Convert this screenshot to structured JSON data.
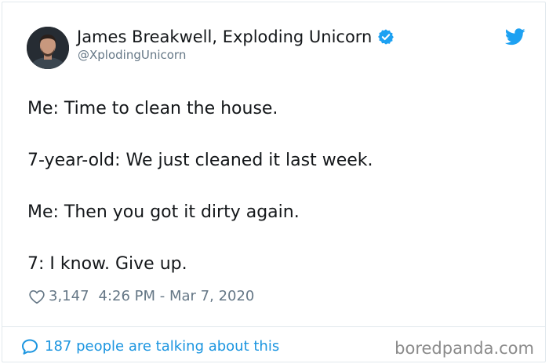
{
  "author": {
    "display_name": "James Breakwell, Exploding Unicorn",
    "handle": "@XplodingUnicorn",
    "verified": true
  },
  "tweet": {
    "lines": [
      "Me: Time to clean the house.",
      "7-year-old: We just cleaned it last week.",
      "Me: Then you got it dirty again.",
      "7: I know. Give up."
    ],
    "likes": "3,147",
    "timestamp": "4:26 PM - Mar 7, 2020"
  },
  "footer": {
    "talking_label": "187 people are talking about this"
  },
  "watermark": "boredpanda.com",
  "colors": {
    "accent": "#1da1f2",
    "link": "#1b95e0",
    "secondary_text": "#657786",
    "primary_text": "#14171a",
    "border": "#e1e8ed"
  },
  "icons": {
    "verified": "verified-badge-icon",
    "brand": "twitter-bird-icon",
    "like": "heart-outline-icon",
    "reply": "speech-bubble-icon"
  }
}
